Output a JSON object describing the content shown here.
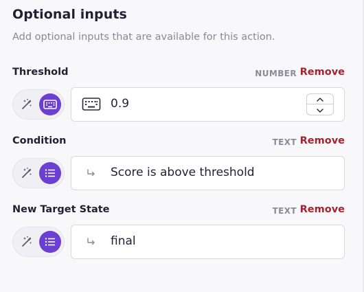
{
  "section": {
    "title": "Optional inputs",
    "subtitle": "Add optional inputs that are available for this action."
  },
  "colors": {
    "accent": "#6a3fd1",
    "remove": "#a5242f",
    "muted": "#8a8796"
  },
  "inputs": [
    {
      "label": "Threshold",
      "type": "NUMBER",
      "remove": "Remove",
      "mode_icon": "keyboard-icon",
      "lead_icon": "keyboard-icon",
      "value": "0.9"
    },
    {
      "label": "Condition",
      "type": "TEXT",
      "remove": "Remove",
      "mode_icon": "list-icon",
      "lead_icon": "return-arrow-icon",
      "value": "Score is above threshold"
    },
    {
      "label": "New Target State",
      "type": "TEXT",
      "remove": "Remove",
      "mode_icon": "list-icon",
      "lead_icon": "return-arrow-icon",
      "value": "final"
    }
  ]
}
